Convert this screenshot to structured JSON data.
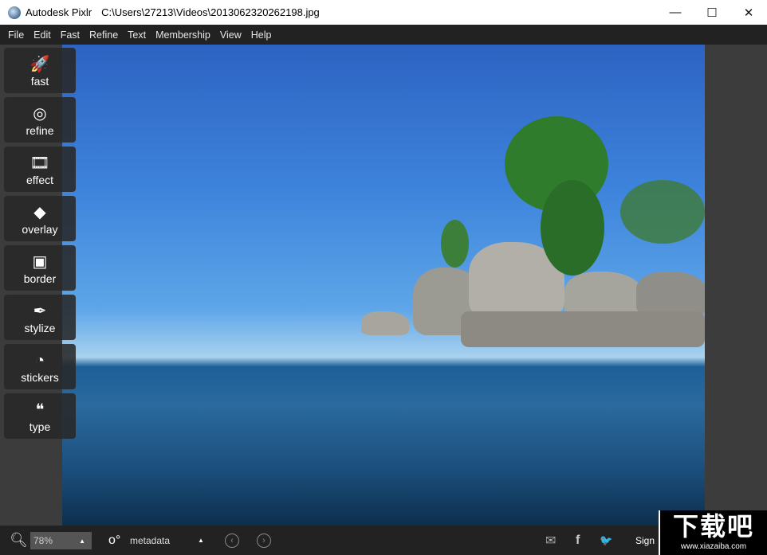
{
  "window": {
    "app_name": "Autodesk Pixlr",
    "file_path": "C:\\Users\\27213\\Videos\\2013062320262198.jpg",
    "minimize": "—",
    "maximize": "☐",
    "close": "✕"
  },
  "menu": [
    "File",
    "Edit",
    "Fast",
    "Refine",
    "Text",
    "Membership",
    "View",
    "Help"
  ],
  "tools": [
    {
      "label": "fast",
      "icon": "🚀"
    },
    {
      "label": "refine",
      "icon": "◎"
    },
    {
      "label": "effect",
      "icon": "🎞"
    },
    {
      "label": "overlay",
      "icon": "◆"
    },
    {
      "label": "border",
      "icon": "▣"
    },
    {
      "label": "stylize",
      "icon": "✒"
    },
    {
      "label": "stickers",
      "icon": "◔"
    },
    {
      "label": "type",
      "icon": "❝"
    }
  ],
  "bottom": {
    "zoom_value": "78%",
    "zoom_arrow": "▲",
    "metadata_label": "metadata",
    "metadata_arrow": "▲",
    "prev": "‹",
    "next": "›",
    "mail_icon": "✉",
    "facebook_icon": "f",
    "twitter_icon": "🐦",
    "sign_label": "Sign"
  },
  "watermark": {
    "big": "下载吧",
    "small": "www.xiazaiba.com"
  }
}
